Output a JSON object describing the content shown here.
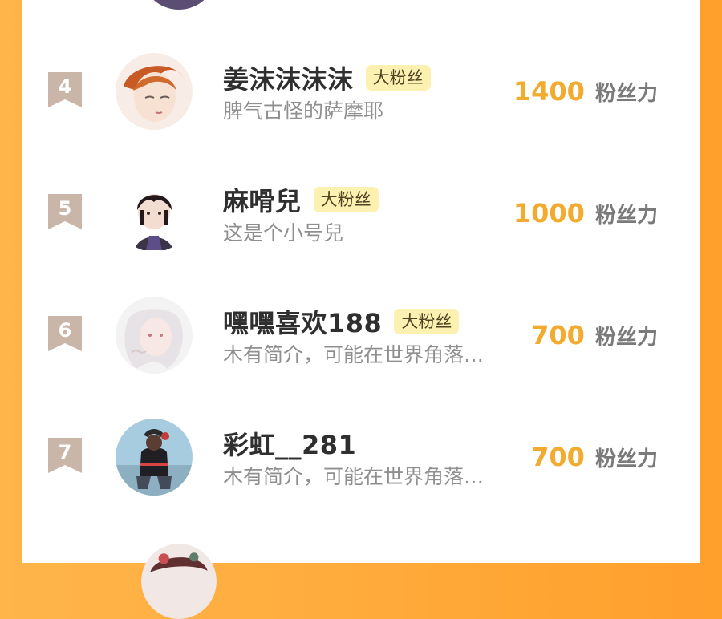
{
  "leaderboard": {
    "rows": [
      {
        "rank": "4",
        "name": "姜沫沫沫沫",
        "badge": "大粉丝",
        "bio": "脾气古怪的萨摩耶",
        "score": "1400",
        "unit": "粉丝力"
      },
      {
        "rank": "5",
        "name": "麻嗗兒",
        "badge": "大粉丝",
        "bio": "这是个小号兒",
        "score": "1000",
        "unit": "粉丝力"
      },
      {
        "rank": "6",
        "name": "嘿嘿喜欢188",
        "badge": "大粉丝",
        "bio": "木有简介，可能在世界角落…",
        "score": "700",
        "unit": "粉丝力"
      },
      {
        "rank": "7",
        "name": "彩虹__281",
        "badge": "",
        "bio": "木有简介，可能在世界角落…",
        "score": "700",
        "unit": "粉丝力"
      }
    ]
  },
  "colors": {
    "background_left": "#ffb54a",
    "background_right": "#ff9f2c",
    "score": "#f2ab2e",
    "badge_bg": "#fdf1b1",
    "rank_badge": "#c9b6a8"
  },
  "icons": {
    "rank_badge": "ribbon-rank-icon",
    "avatar": "avatar-image"
  }
}
